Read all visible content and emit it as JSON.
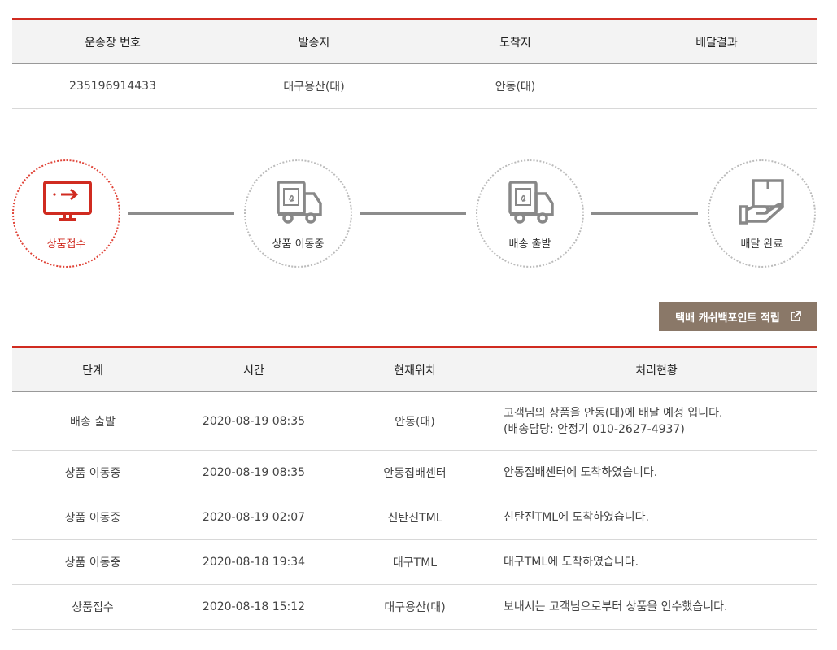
{
  "shipment": {
    "headers": [
      "운송장 번호",
      "발송지",
      "도착지",
      "배달결과"
    ],
    "row": [
      "235196914433",
      "대구용산(대)",
      "안동(대)",
      ""
    ]
  },
  "progress": {
    "steps": [
      {
        "label": "상품접수",
        "icon": "monitor-arrow-icon",
        "active": true
      },
      {
        "label": "상품 이동중",
        "icon": "truck-icon",
        "active": false
      },
      {
        "label": "배송 출발",
        "icon": "truck-icon",
        "active": false
      },
      {
        "label": "배달 완료",
        "icon": "hand-box-icon",
        "active": false
      }
    ],
    "active_color": "#d02b20",
    "inactive_color": "#888888"
  },
  "cashback_button": {
    "label": "택배 캐쉬백포인트 적립",
    "icon": "external-link-icon",
    "color": "#8a7868"
  },
  "tracking": {
    "headers": [
      "단계",
      "시간",
      "현재위치",
      "처리현황"
    ],
    "rows": [
      {
        "stage": "배송 출발",
        "time": "2020-08-19 08:35",
        "location": "안동(대)",
        "status": "고객님의 상품을 안동(대)에 배달 예정 입니다.",
        "status2": "(배송담당: 안정기 010-2627-4937)"
      },
      {
        "stage": "상품 이동중",
        "time": "2020-08-19 08:35",
        "location": "안동집배센터",
        "status": "안동집배센터에 도착하였습니다."
      },
      {
        "stage": "상품 이동중",
        "time": "2020-08-19 02:07",
        "location": "신탄진TML",
        "status": "신탄진TML에 도착하였습니다."
      },
      {
        "stage": "상품 이동중",
        "time": "2020-08-18 19:34",
        "location": "대구TML",
        "status": "대구TML에 도착하였습니다."
      },
      {
        "stage": "상품접수",
        "time": "2020-08-18 15:12",
        "location": "대구용산(대)",
        "status": "보내시는 고객님으로부터 상품을 인수했습니다."
      }
    ]
  },
  "accent_color": "#d02b20"
}
